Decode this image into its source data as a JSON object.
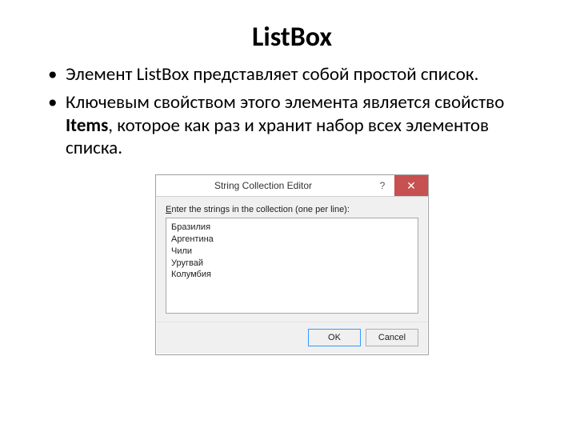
{
  "title": "ListBox",
  "bullets": [
    {
      "pre": "Элемент ",
      "mid": "ListBox",
      "post": " представляет собой простой список."
    },
    {
      "pre": "Ключевым свойством этого элемента является свойство ",
      "bold": "Items",
      "post": ", которое как раз и хранит набор всех элементов списка."
    }
  ],
  "dialog": {
    "title": "String Collection Editor",
    "help_label": "?",
    "close_label": "✕",
    "prompt_pre": "E",
    "prompt_post": "nter the strings in the collection (one per line):",
    "lines": [
      "Бразилия",
      "Аргентина",
      "Чили",
      "Уругвай",
      "Колумбия"
    ],
    "ok_label": "OK",
    "cancel_label": "Cancel"
  }
}
